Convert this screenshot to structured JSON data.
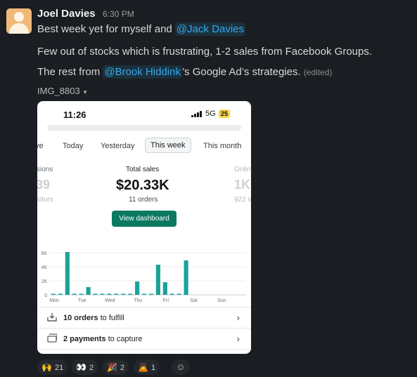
{
  "message": {
    "author": "Joel Davies",
    "time": "6:30 PM",
    "line1_text": "Best week yet for myself and ",
    "line1_mention": "@Jack Davies",
    "line2": "Few out of stocks which is frustrating, 1-2 sales from Facebook Groups.",
    "line3_prefix": "The rest from ",
    "line3_mention": "@Brook Hiddink",
    "line3_suffix": "’s Google Ad’s strategies.",
    "edited": "(edited)",
    "attachment_name": "IMG_8803",
    "attachment_caret": "▾"
  },
  "phone": {
    "status_time": "11:26",
    "network": "5G",
    "battery": "25",
    "tabs": [
      {
        "label": "ve"
      },
      {
        "label": "Today"
      },
      {
        "label": "Yesterday"
      },
      {
        "label": "This week",
        "active": true
      },
      {
        "label": "This month"
      }
    ],
    "left_metric": {
      "label": "sions",
      "value": "39",
      "sub": "sitors"
    },
    "center_metric": {
      "label": "Total sales",
      "value": "$20.33K",
      "sub": "11 orders"
    },
    "right_metric": {
      "label": "Onlin",
      "value": "1K",
      "sub": "922 v"
    },
    "dashboard_button": "View dashboard",
    "rows": [
      {
        "bold": "10 orders",
        "rest": " to fulfill",
        "icon": "inbox-icon"
      },
      {
        "bold": "2 payments",
        "rest": " to capture",
        "icon": "card-icon"
      }
    ],
    "chevron": "›"
  },
  "chart_data": {
    "type": "bar",
    "title": "",
    "xlabel": "",
    "ylabel": "",
    "ylim": [
      0,
      7000
    ],
    "y_ticks": [
      "0",
      "2K",
      "4K",
      "6K"
    ],
    "x_tick_labels": [
      "Mon",
      "Tue",
      "Wed",
      "Thu",
      "Fri",
      "Sat",
      "Sun"
    ],
    "values": [
      100,
      100,
      6100,
      100,
      100,
      1100,
      100,
      100,
      100,
      100,
      100,
      100,
      1900,
      100,
      100,
      4300,
      1800,
      100,
      100,
      4900,
      0,
      0,
      0,
      0,
      0,
      0,
      0,
      0
    ],
    "color": "#1aa39a",
    "grid": true
  },
  "reactions": [
    {
      "emoji": "🙌",
      "count": "21",
      "name": "raised-hands-icon"
    },
    {
      "emoji": "👀",
      "count": "2",
      "name": "eyes-icon"
    },
    {
      "emoji": "🎉",
      "count": "2",
      "name": "party-popper-icon"
    },
    {
      "emoji": "🙇",
      "count": "1",
      "name": "bowing-icon"
    }
  ],
  "add_reaction_glyph": "☺",
  "colors": {
    "background": "#1a1d21",
    "mention": "#35a7ea",
    "button": "#0b7a61",
    "bars": "#1aa39a"
  }
}
